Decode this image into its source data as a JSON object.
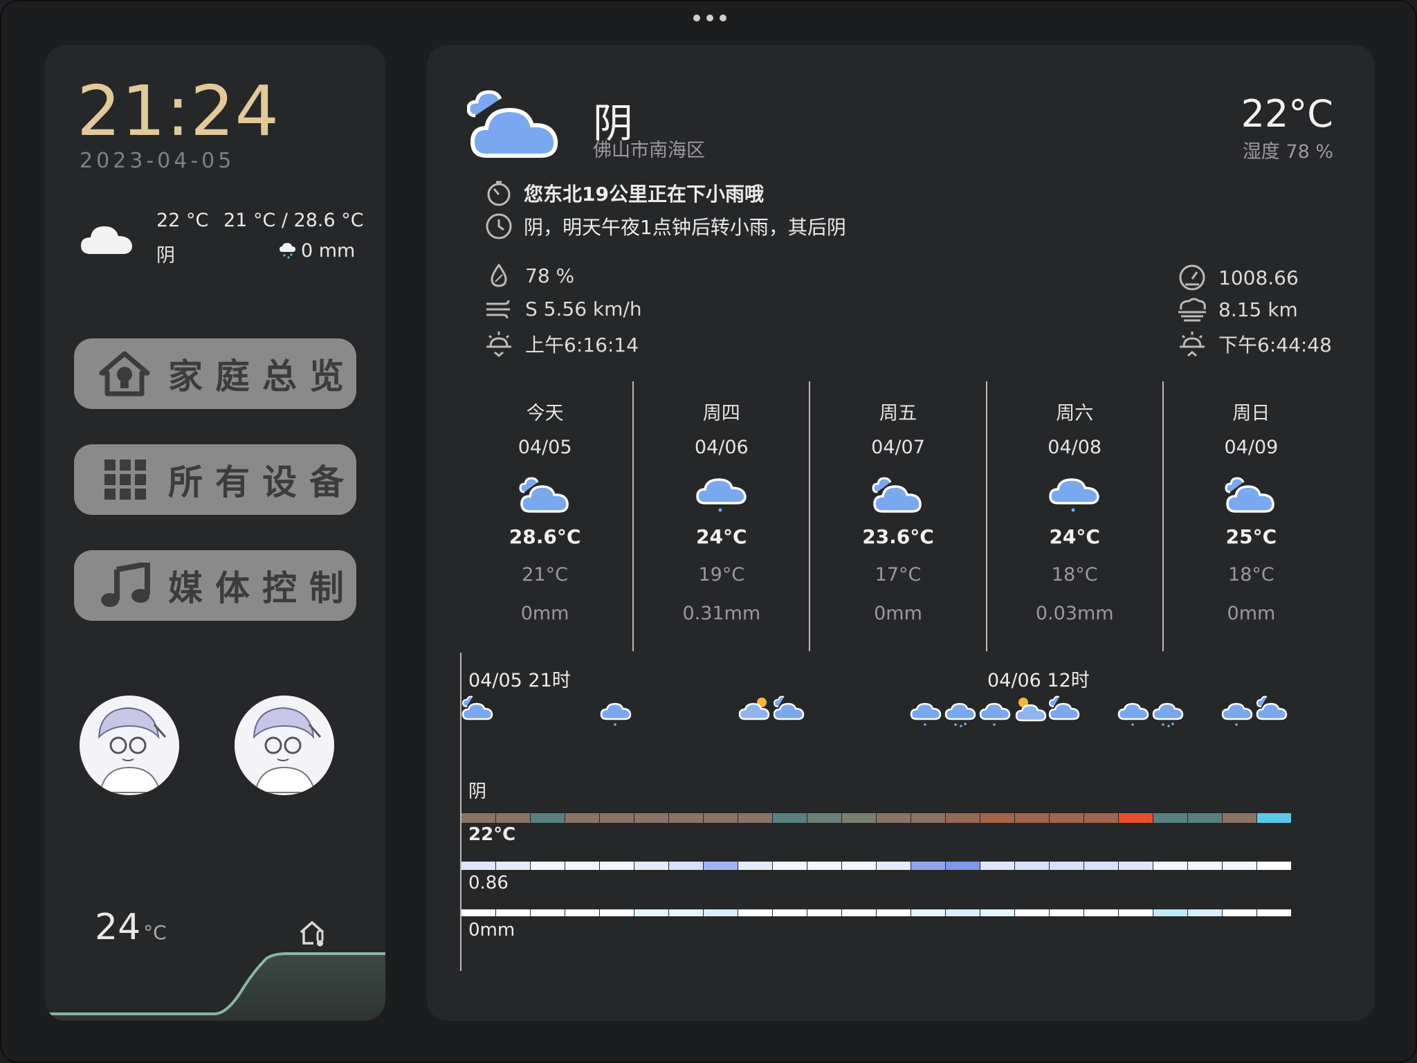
{
  "sidebar": {
    "time": "21:24",
    "date": "2023-04-05",
    "weather_now_temp": "22 °C",
    "weather_range": "21 °C / 28.6 °C",
    "weather_cond": "阴",
    "weather_precip": "0 mm",
    "nav": [
      {
        "label": "家庭总览",
        "icon": "home-bulb-icon"
      },
      {
        "label": "所有设备",
        "icon": "grid-icon"
      },
      {
        "label": "媒体控制",
        "icon": "music-note-icon"
      }
    ],
    "indoor_temp": "24",
    "indoor_temp_unit": "°C",
    "indoor_icon": "home-thermometer-icon"
  },
  "weather": {
    "condition": "阴",
    "location": "佛山市南海区",
    "temp": "22°C",
    "humidity_label": "湿度 78 %",
    "alert": "您东北19公里正在下小雨哦",
    "forecast_text": "阴，明天午夜1点钟后转小雨，其后阴",
    "stats_left": [
      {
        "icon": "humidity-icon",
        "value": "78 %"
      },
      {
        "icon": "wind-icon",
        "value": "S 5.56 km/h"
      },
      {
        "icon": "sunrise-icon",
        "value": "上午6:16:14"
      }
    ],
    "stats_right": [
      {
        "icon": "pressure-gauge-icon",
        "value": "1008.66"
      },
      {
        "icon": "visibility-fog-icon",
        "value": "8.15 km"
      },
      {
        "icon": "sunset-icon",
        "value": "下午6:44:48"
      }
    ],
    "daily": [
      {
        "name": "今天",
        "date": "04/05",
        "icon": "partly-cloudy-icon",
        "high": "28.6°C",
        "low": "21°C",
        "precip": "0mm"
      },
      {
        "name": "周四",
        "date": "04/06",
        "icon": "light-rain-icon",
        "high": "24°C",
        "low": "19°C",
        "precip": "0.31mm"
      },
      {
        "name": "周五",
        "date": "04/07",
        "icon": "partly-cloudy-icon",
        "high": "23.6°C",
        "low": "17°C",
        "precip": "0mm"
      },
      {
        "name": "周六",
        "date": "04/08",
        "icon": "light-rain-icon",
        "high": "24°C",
        "low": "18°C",
        "precip": "0.03mm"
      },
      {
        "name": "周日",
        "date": "04/09",
        "icon": "partly-cloudy-icon",
        "high": "25°C",
        "low": "18°C",
        "precip": "0mm"
      }
    ],
    "hourly": {
      "start_label": "04/05 21时",
      "mid_label": "04/06 12时",
      "condition": "阴",
      "temp_label": "22°C",
      "cloud_label": "0.86",
      "precip_label": "0mm",
      "temp_colors": [
        "#8a7466",
        "#8a7466",
        "#5a8080",
        "#8a7466",
        "#8a7466",
        "#8a7466",
        "#8a7466",
        "#8a7466",
        "#8a7466",
        "#5a8080",
        "#6a8078",
        "#7a8070",
        "#8a7466",
        "#8a7466",
        "#956a58",
        "#a6644a",
        "#a06652",
        "#a06652",
        "#a06652",
        "#e8502c",
        "#5a8080",
        "#5a8080",
        "#8a7466",
        "#5cc8e8"
      ],
      "cloud_colors": [
        "#dfe6ff",
        "#e6ecff",
        "#f4f6ff",
        "#f4f6ff",
        "#f4f6ff",
        "#e6ecff",
        "#d6e0ff",
        "#9fb4f4",
        "#e6ecff",
        "#f4f6ff",
        "#f4f6ff",
        "#f4f6ff",
        "#e6ecff",
        "#8fa6ee",
        "#7f98ea",
        "#dfe6ff",
        "#d6e0ff",
        "#d6e0ff",
        "#d6e0ff",
        "#dfe6ff",
        "#f4f6ff",
        "#f4f6ff",
        "#f4f6ff",
        "#ffffff"
      ],
      "precip_colors": [
        "#ffffff",
        "#ffffff",
        "#ffffff",
        "#ffffff",
        "#ffffff",
        "#e4f4fc",
        "#e4f4fc",
        "#d4eefa",
        "#ffffff",
        "#ffffff",
        "#ffffff",
        "#ffffff",
        "#ffffff",
        "#e4f4fc",
        "#d4eefa",
        "#e4f4fc",
        "#ffffff",
        "#ffffff",
        "#ffffff",
        "#ffffff",
        "#bfe8fa",
        "#d4eefa",
        "#ffffff",
        "#ffffff"
      ]
    }
  }
}
